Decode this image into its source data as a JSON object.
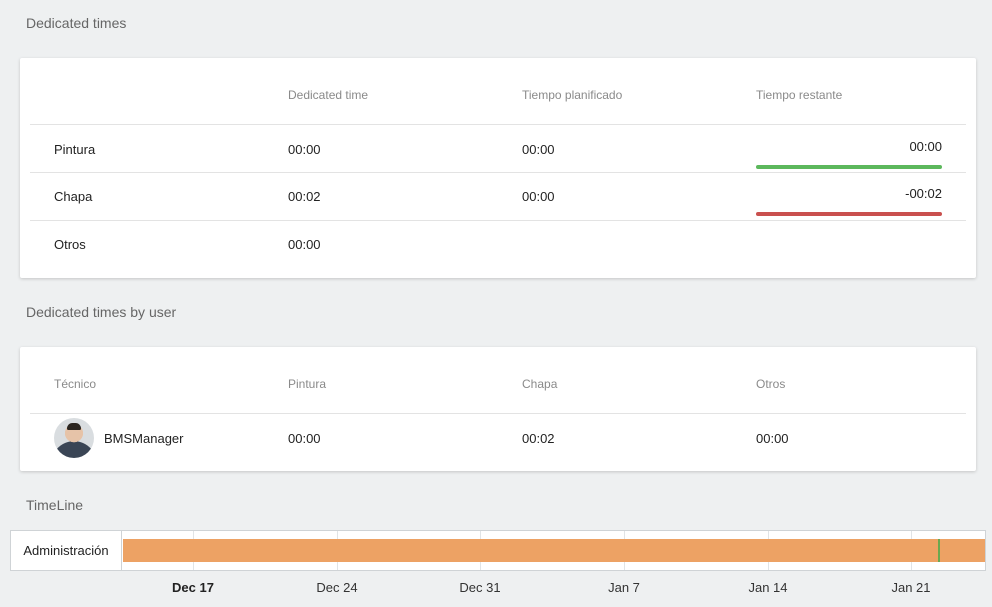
{
  "sections": {
    "dedicated_times_title": "Dedicated times",
    "by_user_title": "Dedicated times by user",
    "timeline_title": "TimeLine"
  },
  "dedicated_times": {
    "headers": [
      "",
      "Dedicated time",
      "Tiempo planificado",
      "Tiempo restante"
    ],
    "rows": [
      {
        "name": "Pintura",
        "dedicated": "00:00",
        "planned": "00:00",
        "remaining": "00:00",
        "status_color": "#5cb85c"
      },
      {
        "name": "Chapa",
        "dedicated": "00:02",
        "planned": "00:00",
        "remaining": "-00:02",
        "status_color": "#c9504e"
      },
      {
        "name": "Otros",
        "dedicated": "00:00",
        "planned": "",
        "remaining": "",
        "status_color": ""
      }
    ]
  },
  "by_user": {
    "headers": [
      "Técnico",
      "Pintura",
      "Chapa",
      "Otros"
    ],
    "rows": [
      {
        "user": "BMSManager",
        "pintura": "00:00",
        "chapa": "00:02",
        "otros": "00:00"
      }
    ]
  },
  "timeline": {
    "row_label": "Administración",
    "bar_color": "#eda264",
    "marker_color": "#6aa84f",
    "ticks": [
      "Dec 17",
      "Dec 24",
      "Dec 31",
      "Jan 7",
      "Jan 14",
      "Jan 21"
    ],
    "highlighted_tick": "Dec 17"
  }
}
